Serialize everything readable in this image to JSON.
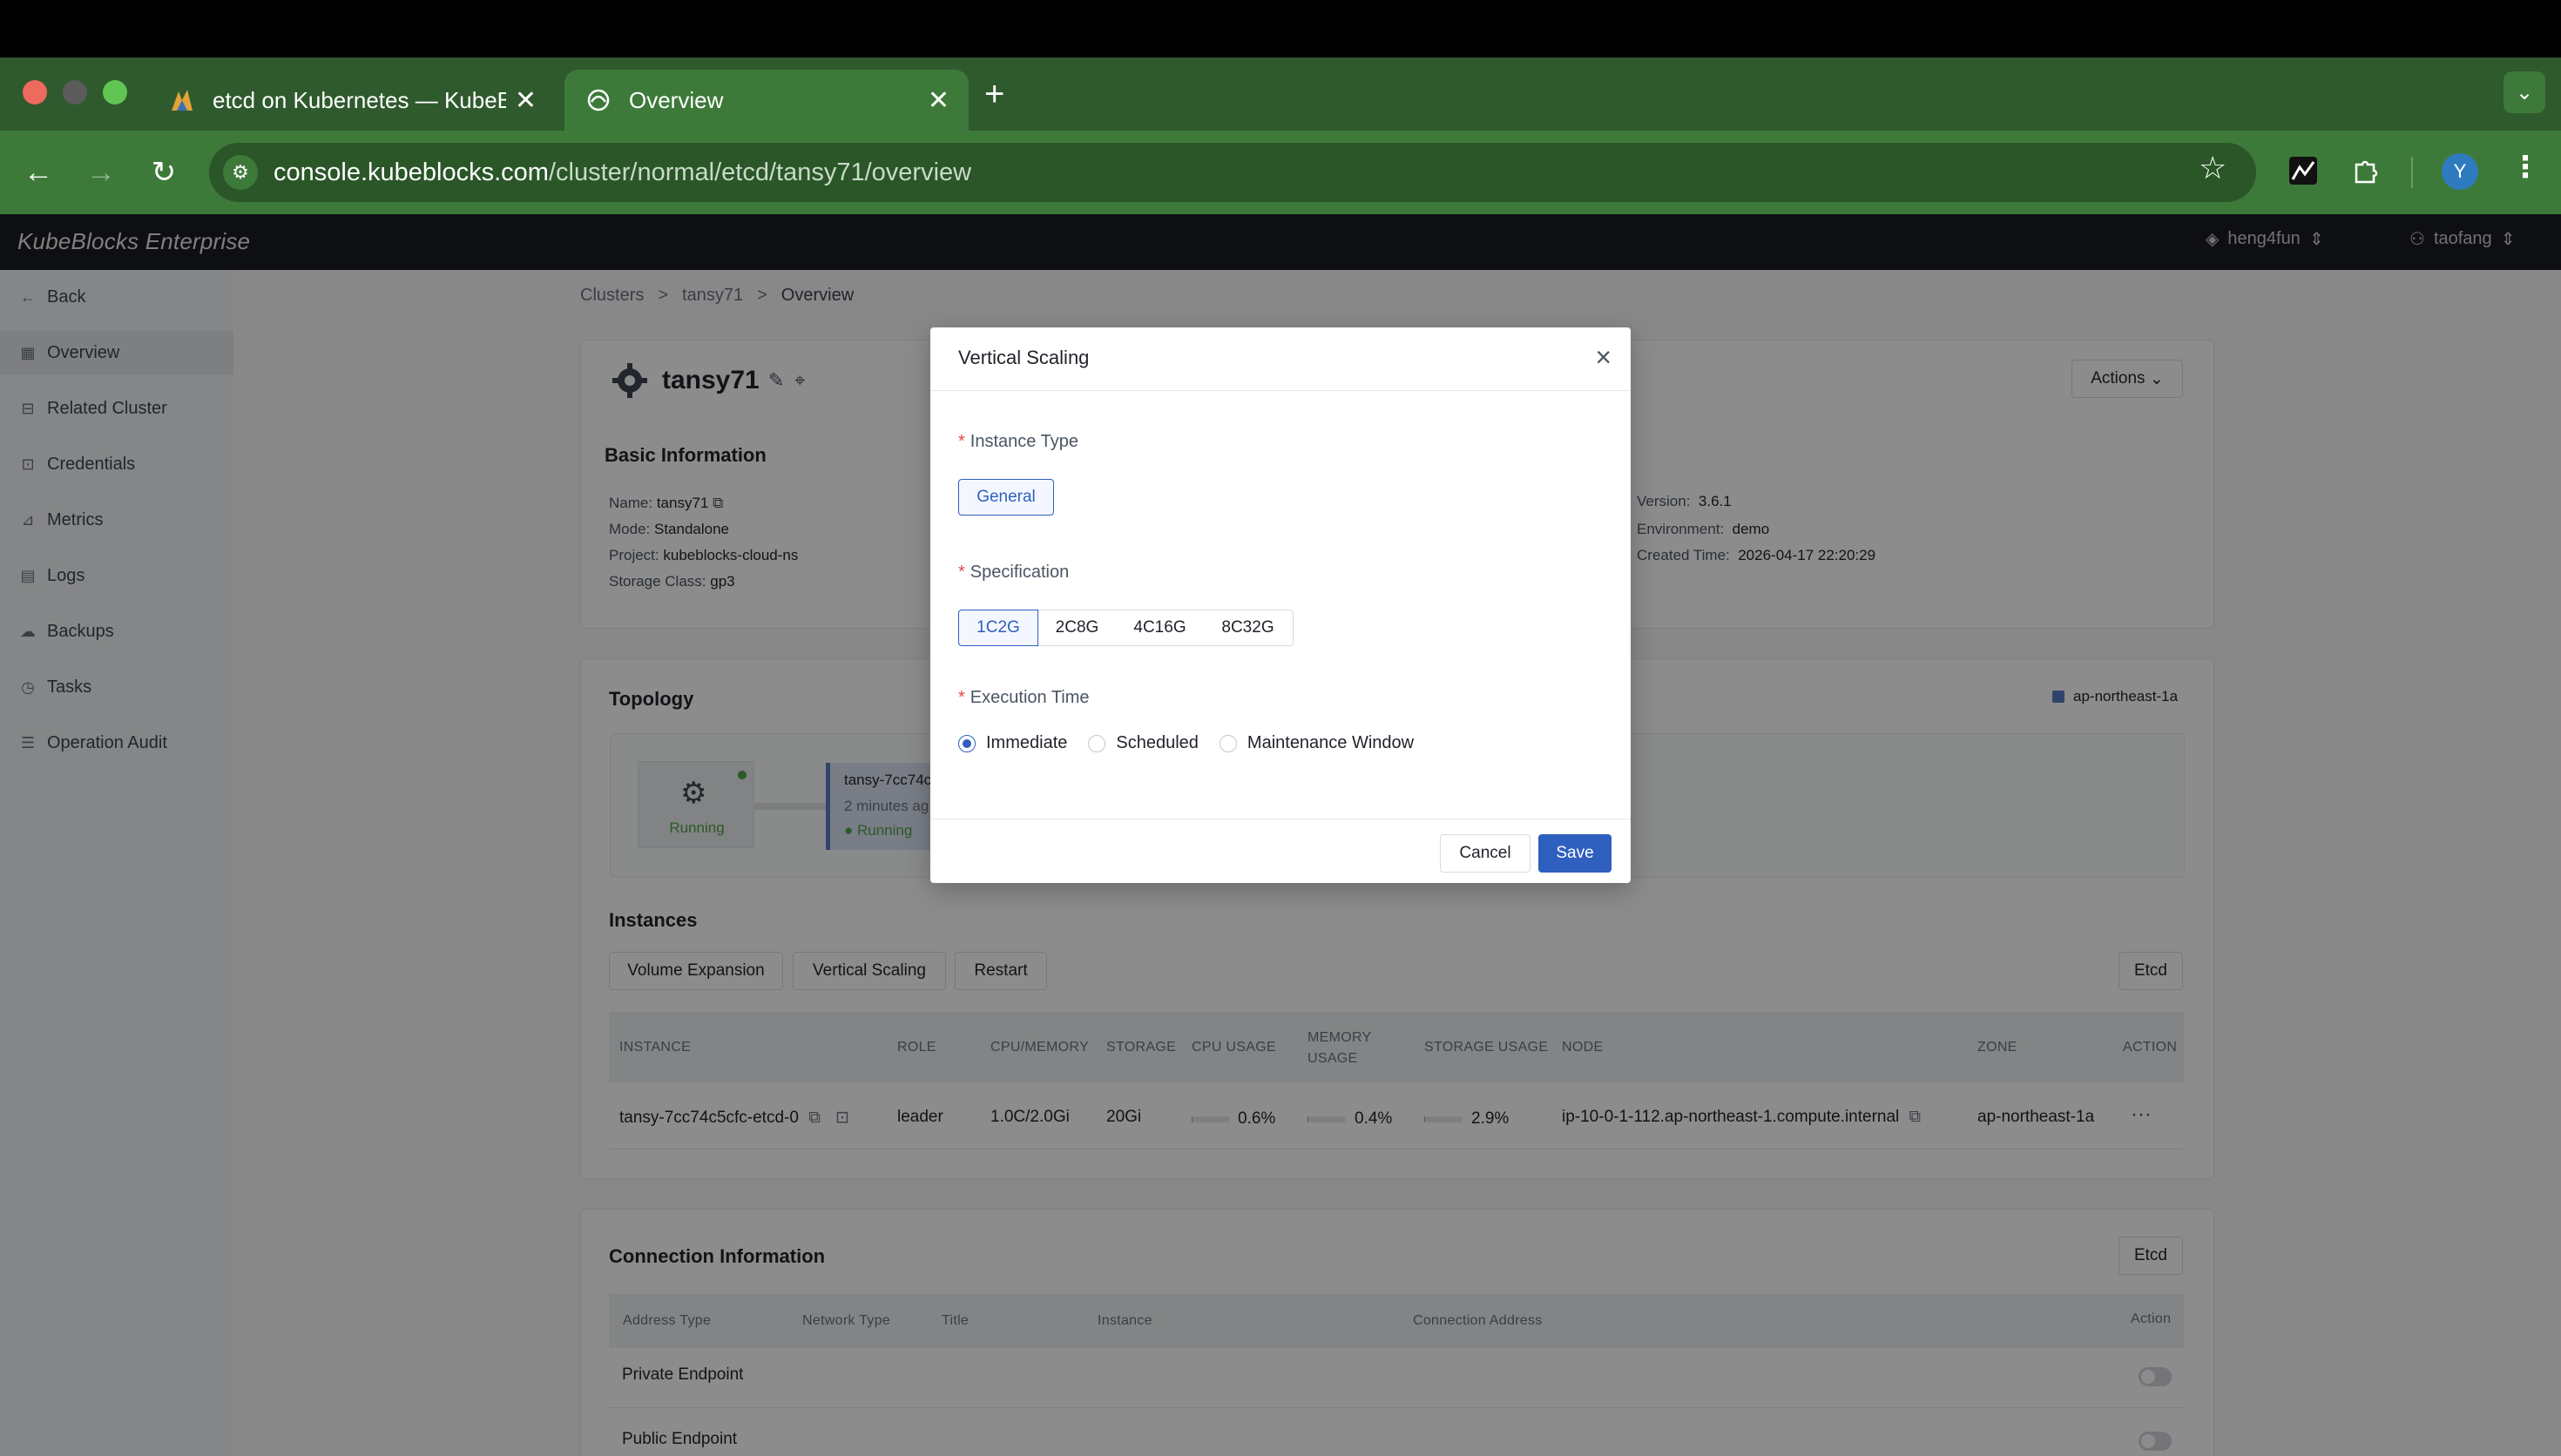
{
  "browser": {
    "tabs": [
      {
        "title": "etcd on Kubernetes — KubeBl",
        "icon": "kubeblocks-icon"
      },
      {
        "title": "Overview",
        "icon": "app-icon"
      }
    ],
    "url_host": "console.kubeblocks.com",
    "url_path": "/cluster/normal/etcd/tansy71/overview",
    "avatar_letter": "Y"
  },
  "header": {
    "brand": "KubeBlocks Enterprise",
    "org": "heng4fun",
    "user": "taofang"
  },
  "sidebar": {
    "back": "Back",
    "items": [
      {
        "label": "Overview",
        "icon": "grid-icon"
      },
      {
        "label": "Related Cluster",
        "icon": "cluster-icon"
      },
      {
        "label": "Credentials",
        "icon": "key-icon"
      },
      {
        "label": "Metrics",
        "icon": "chart-icon"
      },
      {
        "label": "Logs",
        "icon": "document-icon"
      },
      {
        "label": "Backups",
        "icon": "cloud-icon"
      },
      {
        "label": "Tasks",
        "icon": "clock-icon"
      },
      {
        "label": "Operation Audit",
        "icon": "list-icon"
      }
    ]
  },
  "breadcrumb": [
    "Clusters",
    "tansy71",
    "Overview"
  ],
  "cluster": {
    "name": "tansy71",
    "actions_label": "Actions",
    "basic_info_title": "Basic Information",
    "info_left": [
      {
        "label": "Name:",
        "value": "tansy71"
      },
      {
        "label": "Mode:",
        "value": "Standalone"
      },
      {
        "label": "Project:",
        "value": "kubeblocks-cloud-ns"
      },
      {
        "label": "Storage Class:",
        "value": "gp3"
      }
    ],
    "info_right": [
      {
        "label": "Version:",
        "value": "3.6.1"
      },
      {
        "label": "Environment:",
        "value": "demo"
      },
      {
        "label": "Created Time:",
        "value": "2026-04-17 22:20:29"
      }
    ]
  },
  "topology": {
    "title": "Topology",
    "zone_legend": "ap-northeast-1a",
    "node_status": "Running",
    "pod_name": "tansy-7cc74c",
    "pod_age": "2 minutes ag",
    "pod_status": "Running"
  },
  "instances": {
    "title": "Instances",
    "buttons": [
      "Volume Expansion",
      "Vertical Scaling",
      "Restart"
    ],
    "component": "Etcd",
    "columns": [
      "INSTANCE",
      "ROLE",
      "CPU/MEMORY",
      "STORAGE",
      "CPU USAGE",
      "MEMORY USAGE",
      "STORAGE USAGE",
      "NODE",
      "ZONE",
      "ACTION"
    ],
    "rows": [
      {
        "instance": "tansy-7cc74c5cfc-etcd-0",
        "role": "leader",
        "cpu_memory": "1.0C/2.0Gi",
        "storage": "20Gi",
        "cpu_usage": "0.6%",
        "cpu_usage_frac": 0.006,
        "memory_usage": "0.4%",
        "memory_usage_frac": 0.004,
        "storage_usage": "2.9%",
        "storage_usage_frac": 0.029,
        "node": "ip-10-0-1-112.ap-northeast-1.compute.internal",
        "zone": "ap-northeast-1a",
        "action": "···"
      }
    ]
  },
  "connection": {
    "title": "Connection Information",
    "component": "Etcd",
    "columns": [
      "Address Type",
      "Network Type",
      "Title",
      "Instance",
      "Connection Address",
      "Action"
    ],
    "rows": [
      {
        "address_type": "Private Endpoint",
        "enabled": false
      },
      {
        "address_type": "Public Endpoint",
        "enabled": false
      }
    ]
  },
  "modal": {
    "title": "Vertical Scaling",
    "instance_type_label": "Instance Type",
    "instance_type_value": "General",
    "specification_label": "Specification",
    "spec_options": [
      "1C2G",
      "2C8G",
      "4C16G",
      "8C32G"
    ],
    "spec_selected": "1C2G",
    "execution_time_label": "Execution Time",
    "execution_options": [
      "Immediate",
      "Scheduled",
      "Maintenance Window"
    ],
    "execution_selected": "Immediate",
    "cancel_label": "Cancel",
    "save_label": "Save"
  },
  "colors": {
    "accent": "#2f5fbf",
    "chrome_green": "#3d7a3a",
    "running_green": "#52a447"
  }
}
